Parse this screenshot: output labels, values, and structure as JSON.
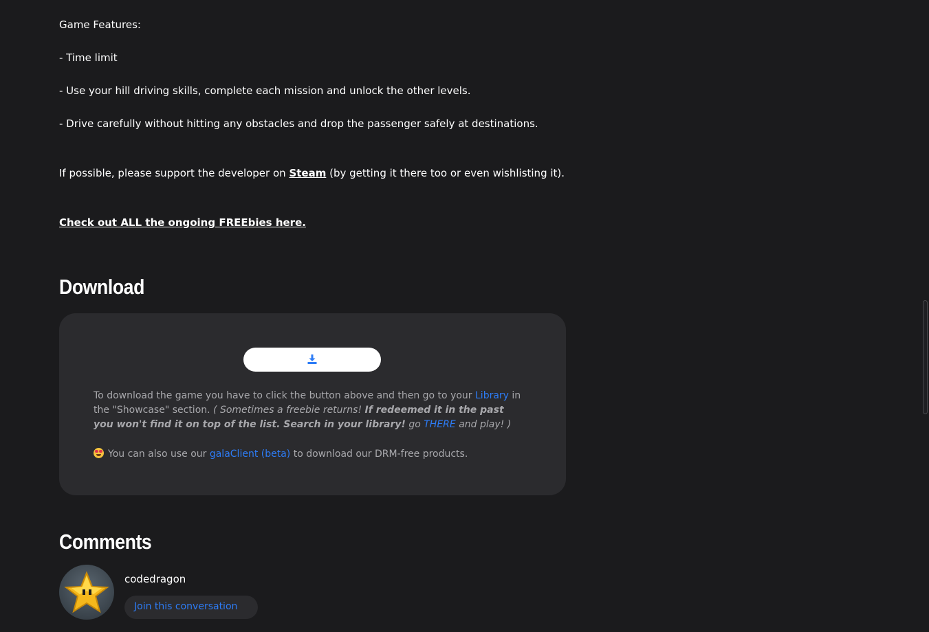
{
  "description": {
    "features_heading": "Game Features:",
    "features": [
      "- Time limit",
      "- Use your hill driving skills, complete each mission and unlock the other levels.",
      "- Drive carefully without hitting any obstacles and drop the passenger safely at destinations."
    ],
    "support_prefix": "If possible, please support the developer on ",
    "support_link": "Steam",
    "support_suffix": " (by getting it there too or even wishlisting it).",
    "freebies_link": "Check out ALL the ongoing FREEbies here."
  },
  "download": {
    "title": "Download",
    "button_icon": "download-icon",
    "text_1": "To download the game you have to click the button above and then go to your ",
    "library_link": "Library",
    "text_2": " in the \"Showcase\" section. ",
    "italic_1": "( Sometimes a freebie returns! ",
    "bold_italic": "If redeemed it in the past you won't find it on top of the list. Search in your library!",
    "italic_2": " go ",
    "there_link": "THERE",
    "italic_3": " and play! )",
    "client_prefix": "You can also use our ",
    "client_link": "galaClient (beta)",
    "client_suffix": " to download our DRM-free products.",
    "emoji_icon": "star-struck-emoji-icon"
  },
  "comments": {
    "title": "Comments",
    "username": "codedragon",
    "join_label": "Join this conversation",
    "avatar_icon": "star-avatar-icon"
  },
  "colors": {
    "background": "#1b1b1d",
    "panel": "#2b2b2e",
    "link_blue": "#2d7cf6",
    "muted_text": "#a8a8ac"
  }
}
